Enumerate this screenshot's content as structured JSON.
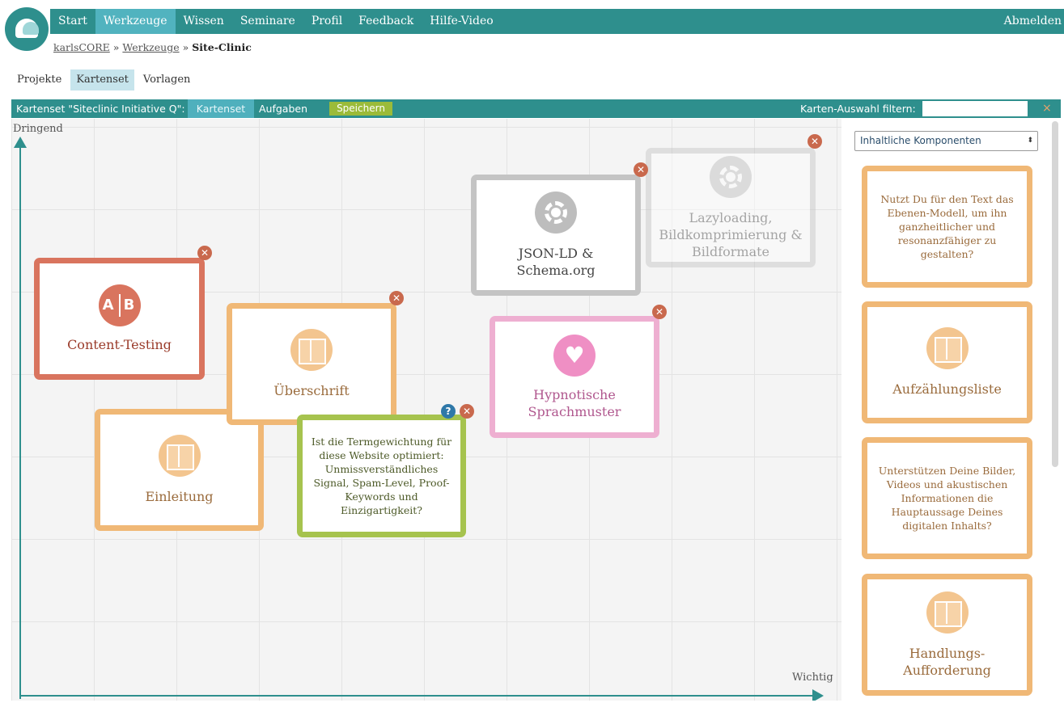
{
  "nav": {
    "items": [
      "Start",
      "Werkzeuge",
      "Wissen",
      "Seminare",
      "Profil",
      "Feedback",
      "Hilfe-Video"
    ],
    "logout": "Abmelden"
  },
  "breadcrumb": {
    "root": "karlsCORE",
    "sep": "»",
    "section": "Werkzeuge",
    "current": "Site-Clinic"
  },
  "subtabs": [
    "Projekte",
    "Kartenset",
    "Vorlagen"
  ],
  "toolbar": {
    "title": "Kartenset \"Siteclinic Initiative Q\":",
    "kartenset": "Kartenset",
    "aufgaben": "Aufgaben",
    "save": "Speichern",
    "filter_label": "Karten-Auswahl filtern:",
    "filter_value": "",
    "close": "×"
  },
  "board": {
    "y_label": "Dringend",
    "x_label": "Wichtig",
    "cards": {
      "content_testing": {
        "title": "Content-Testing",
        "icon": "ab-icon",
        "icon_a": "A",
        "icon_b": "B"
      },
      "ueberschrift": {
        "title": "Überschrift"
      },
      "einleitung": {
        "title": "Einleitung"
      },
      "termgewichtung": {
        "question": "Ist die Termgewichtung für diese Website optimiert: Unmissverständliches Signal, Spam-Level, Proof-Keywords und Einzigartigkeit?"
      },
      "json_ld": {
        "title": "JSON-LD & Schema.org"
      },
      "lazyloading": {
        "title": "Lazyloading, Bildkomprimierung & Bildformate"
      },
      "hypnotische": {
        "title": "Hypnotische Sprachmuster",
        "icon_glyph": "♥"
      }
    }
  },
  "sidebar": {
    "select_value": "Inhaltliche Komponenten",
    "select_arrow": "⬍",
    "cards": [
      {
        "question": "Nutzt Du für den Text das Ebenen-Modell, um ihn ganzheitlicher und resonanzfähiger zu gestalten?"
      },
      {
        "title": "Aufzählungsliste"
      },
      {
        "question": "Unterstützen Deine Bilder, Videos und akustischen Informationen die Hauptaussage Deines digitalen Inhalts?"
      },
      {
        "title": "Handlungs-Aufforderung"
      }
    ]
  },
  "buttons": {
    "close_glyph": "✕",
    "help_glyph": "?"
  },
  "colors": {
    "teal": "#2e8f8d",
    "teal_light": "#51b3bf",
    "save_green": "#9bbb39",
    "orange_card": "#f0b876",
    "red_card": "#d9745e",
    "pink_card": "#eeafd1",
    "green_card": "#a6c34e",
    "grey_card": "#c4c4c4"
  }
}
